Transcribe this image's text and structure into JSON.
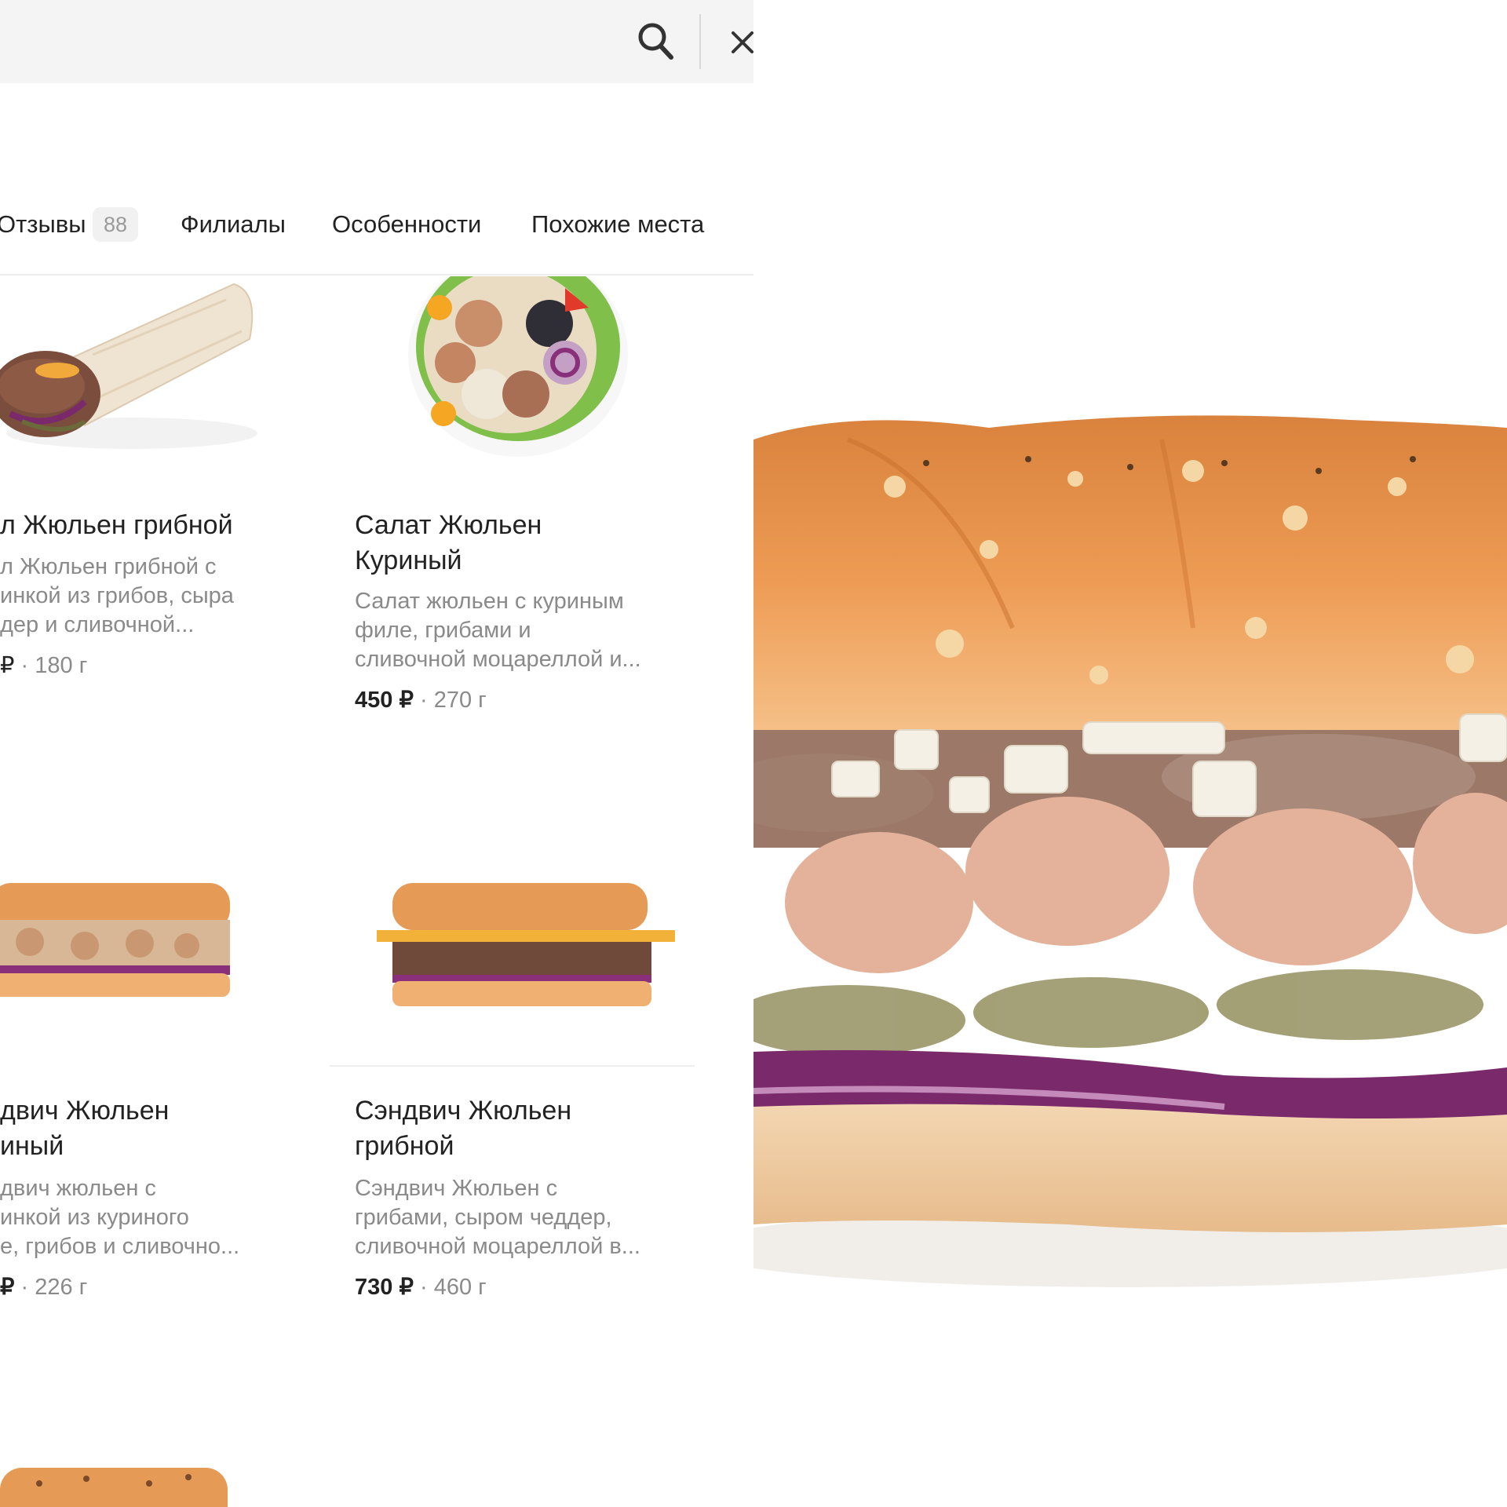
{
  "search": {
    "placeholder": ""
  },
  "tabs": [
    {
      "label": "Отзывы",
      "badge": "88"
    },
    {
      "label": "Филиалы"
    },
    {
      "label": "Особенности"
    },
    {
      "label": "Похожие места"
    }
  ],
  "items": [
    {
      "title": "л Жюльен грибной",
      "desc": "л Жюльен грибной с\nинкой из грибов, сыра\nдер и сливочной...",
      "price": "₽",
      "weight": "180 г"
    },
    {
      "title": "Салат Жюльен\nКуриный",
      "desc": "Салат жюльен с куриным\nфиле, грибами и\nсливочной моцареллой и...",
      "price": "450 ₽",
      "weight": "270 г"
    },
    {
      "title": "двич Жюльен\nиный",
      "desc": "двич жюльен с\nинкой из куриного\nе, грибов и сливочно...",
      "price": "₽",
      "weight": "226 г"
    },
    {
      "title": "Сэндвич Жюльен\nгрибной",
      "desc": "Сэндвич Жюльен с\nгрибами, сыром чеддер,\nсливочной моцареллой в...",
      "price": "730 ₽",
      "weight": "460 г"
    }
  ],
  "separator": "·",
  "colors": {
    "search_bg": "#f4f4f4",
    "text": "#222222",
    "muted": "#8a8a8a",
    "bread": "#e9964f",
    "onion": "#7a2a6a"
  }
}
